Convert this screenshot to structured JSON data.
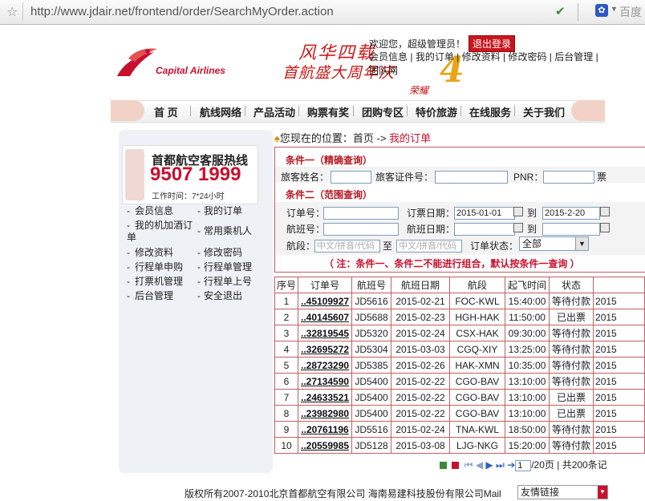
{
  "browser": {
    "url": "http://www.jdair.net/frontend/order/SearchMyOrder.action",
    "search_engine_label": "百度"
  },
  "header": {
    "logo_text": "Capital Airlines",
    "banner_line1": "风华四载",
    "banner_line2": "首航盛大周年庆",
    "banner_number": "4",
    "banner_sub": "荣耀",
    "welcome": "欢迎您，超级管理员！",
    "logout_label": "退出登录",
    "user_menu": [
      "会员信息",
      "我的订单",
      "修改资料",
      "修改密码",
      "后台管理",
      "团队网"
    ]
  },
  "nav": {
    "items": [
      "首 页",
      "航线网络",
      "产品活动",
      "购票有奖",
      "团购专区",
      "特价旅游",
      "在线服务",
      "关于我们"
    ]
  },
  "sidebar": {
    "hotline_title": "首都航空客服热线",
    "hotline_number": "9507 1999",
    "hotline_hours": "工作时间：7*24小时",
    "links_left": [
      "会员信息",
      "我的机加酒订单",
      "修改资料",
      "行程单申购",
      "打票机管理",
      "后台管理"
    ],
    "links_right": [
      "我的订单",
      "常用乘机人",
      "修改密码",
      "行程单管理",
      "行程单上号",
      "安全退出"
    ]
  },
  "breadcrumb": {
    "prefix": "您现在的位置：首页 ->",
    "current": "我的订单"
  },
  "query": {
    "section1_title": "条件一（精确查询）",
    "passenger_name_label": "旅客姓名：",
    "passenger_id_label": "旅客证件号：",
    "pnr_label": "PNR：",
    "ticket_label": "票",
    "section2_title": "条件二（范围查询）",
    "order_no_label": "订单号：",
    "booking_date_label": "订票日期：",
    "booking_date_from": "2015-01-01",
    "to_label": "到",
    "booking_date_to": "2015-2-20",
    "flight_no_label": "航班号：",
    "flight_date_label": "航班日期：",
    "segment_label": "航段：",
    "segment_from_placeholder": "中文/拼音/代码",
    "segment_to_label": "至",
    "segment_to_placeholder": "中文/拼音/代码",
    "order_status_label": "订单状态：",
    "order_status_value": "全部",
    "note": "（ 注：条件一、条件二不能进行组合，默认按条件一查询 ）"
  },
  "table": {
    "headers": [
      "序号",
      "订单号",
      "航班号",
      "航班日期",
      "航段",
      "起飞时间",
      "状态",
      ""
    ],
    "rows": [
      [
        "1",
        "..45109927",
        "JD5616",
        "2015-02-21",
        "FOC-KWL",
        "15:40:00",
        "等待付款",
        "2015"
      ],
      [
        "2",
        "..40145607",
        "JD5688",
        "2015-02-23",
        "HGH-HAK",
        "11:50:00",
        "已出票",
        "2015"
      ],
      [
        "3",
        "..32819545",
        "JD5320",
        "2015-02-24",
        "CSX-HAK",
        "09:30:00",
        "等待付款",
        "2015"
      ],
      [
        "4",
        "..32695272",
        "JD5304",
        "2015-03-03",
        "CGQ-XIY",
        "13:25:00",
        "等待付款",
        "2015"
      ],
      [
        "5",
        "..28723290",
        "JD5385",
        "2015-02-26",
        "HAK-XMN",
        "10:35:00",
        "等待付款",
        "2015"
      ],
      [
        "6",
        "..27134590",
        "JD5400",
        "2015-02-22",
        "CGO-BAV",
        "13:10:00",
        "等待付款",
        "2015"
      ],
      [
        "7",
        "..24633521",
        "JD5400",
        "2015-02-22",
        "CGO-BAV",
        "13:10:00",
        "已出票",
        "2015"
      ],
      [
        "8",
        "..23982980",
        "JD5400",
        "2015-02-22",
        "CGO-BAV",
        "13:10:00",
        "已出票",
        "2015"
      ],
      [
        "9",
        "..20761196",
        "JD5516",
        "2015-02-24",
        "TNA-KWL",
        "18:50:00",
        "等待付款",
        "2015"
      ],
      [
        "10",
        "..20559985",
        "JD5128",
        "2015-03-08",
        "LJG-NKG",
        "15:20:00",
        "等待付款",
        "2015"
      ]
    ]
  },
  "pager": {
    "current_page": "1",
    "total_pages_text": "/20页",
    "total_records_text": "共200条记"
  },
  "footer": {
    "copyright": "版权所有2007-2010北京首都航空有限公司 海南易建科技股份有限公司Mail",
    "friendly_links": "友情链接"
  },
  "colors": {
    "brand_red": "#c8102e",
    "border_red": "#c06060"
  }
}
